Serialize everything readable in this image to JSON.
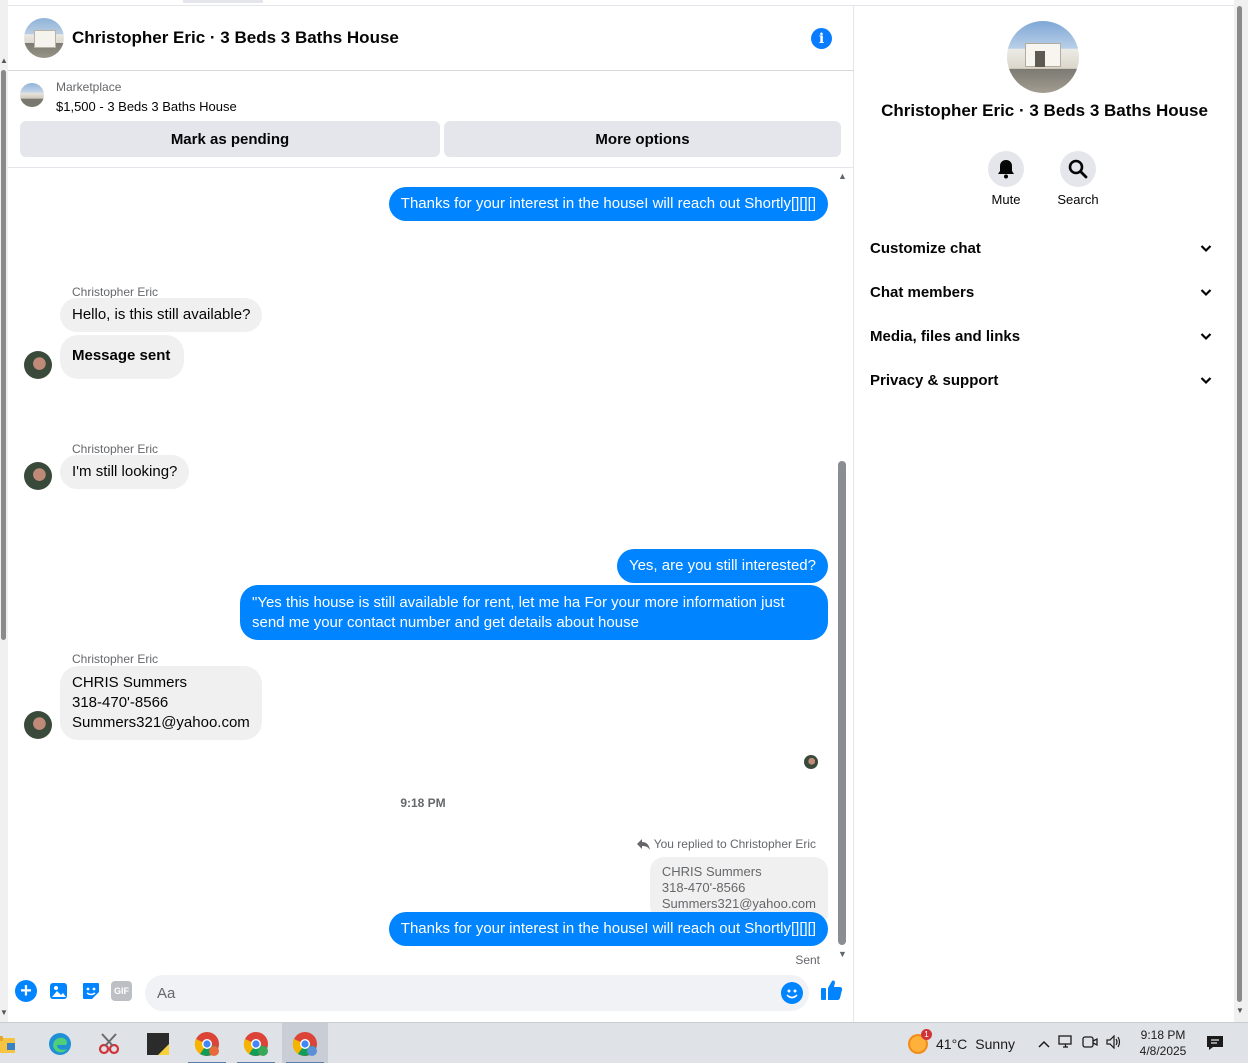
{
  "chat": {
    "title": "Christopher Eric · 3 Beds 3 Baths House",
    "marketplace": {
      "category": "Marketplace",
      "listing": "$1,500 - 3 Beds 3 Baths House",
      "mark_pending_label": "Mark as pending",
      "more_options_label": "More options"
    },
    "messages": {
      "out_1": "Thanks for your interest in the houseI will reach out Shortly[][][]",
      "sender_name_1": "Christopher Eric",
      "in_1": "Hello, is this still available?",
      "in_2": "Message sent",
      "sender_name_2": "Christopher Eric",
      "in_3": "I'm still looking?",
      "out_2": "Yes, are you still interested?",
      "out_3": "\"Yes this house is still available for rent, let me ha For  your  more  information  just send  me   your  contact  number  and get details about house",
      "sender_name_3": "Christopher Eric",
      "in_4_line1": "CHRIS Summers",
      "in_4_line2": "318-470'-8566",
      "in_4_line3": "Summers321@yahoo.com",
      "timestamp": "9:18 PM",
      "reply_note": "You replied to Christopher Eric",
      "quote_line1": "CHRIS Summers",
      "quote_line2": "318-470'-8566",
      "quote_line3": "Summers321@yahoo.com",
      "out_4": "Thanks for your interest in the houseI will reach out Shortly[][][]",
      "status": "Sent"
    },
    "composer": {
      "placeholder": "Aa"
    }
  },
  "info_panel": {
    "title": "Christopher Eric · 3 Beds 3 Baths House",
    "mute_label": "Mute",
    "search_label": "Search",
    "sections": [
      "Customize chat",
      "Chat members",
      "Media, files and links",
      "Privacy & support"
    ]
  },
  "taskbar": {
    "temperature": "41°C",
    "condition": "Sunny",
    "weather_badge": "1",
    "time": "9:18 PM",
    "date": "4/8/2025"
  },
  "colors": {
    "messenger_blue": "#0084ff",
    "bubble_gray": "#f0f0f0",
    "button_gray": "#e4e6eb"
  }
}
